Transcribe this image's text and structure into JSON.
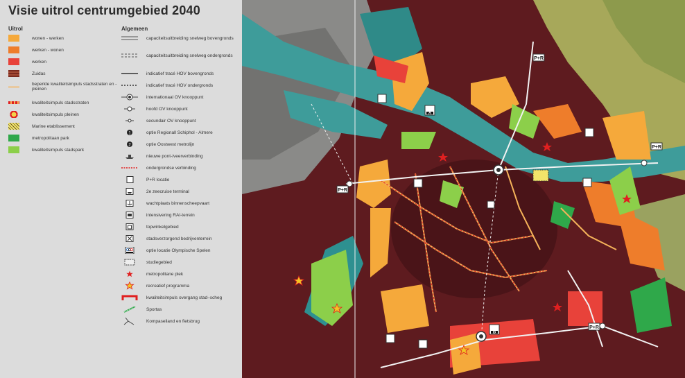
{
  "title": "Visie uitrol centrumgebied 2040",
  "legend": {
    "uitrol_heading": "Uitrol",
    "algemeen_heading": "Algemeen",
    "uitrol_items": [
      {
        "label": "wonen - werken",
        "color": "#f5a93b"
      },
      {
        "label": "werken - wonen",
        "color": "#ee7d2b"
      },
      {
        "label": "werken",
        "color": "#e8423a"
      },
      {
        "label": "Zuidas",
        "color": "#7a2a1e"
      },
      {
        "label": "beperkte kwaliteitsimpuls stadsstraten en -pleinen",
        "color": "#e8c9a0"
      },
      {
        "label": "kwaliteitsimpuls stadsstraten",
        "color": "#e02020"
      },
      {
        "label": "kwaliteitsimpuls pleinen",
        "color": "#f2d24a"
      },
      {
        "label": "Marine etablissement",
        "color": "#f2e46a"
      },
      {
        "label": "metropolitaan park",
        "color": "#2fa84a"
      },
      {
        "label": "kwaliteitsimpuls stadspark",
        "color": "#8ccf4a"
      }
    ],
    "algemeen_items": [
      {
        "label": "capaciteitsuitbreiding snelweg bovengronds",
        "icon": "double-line-icon"
      },
      {
        "label": "capaciteitsuitbreiding snelweg ondergronds",
        "icon": "double-dashed-line-icon"
      },
      {
        "label": "indicatief tracé HOV bovengronds",
        "icon": "solid-line-icon"
      },
      {
        "label": "indicatief tracé HOV ondergronds",
        "icon": "dashed-line-icon"
      },
      {
        "label": "internationaal OV knooppunt",
        "icon": "large-node-icon"
      },
      {
        "label": "hoofd OV knooppunt",
        "icon": "medium-node-icon"
      },
      {
        "label": "secundair OV knooppunt",
        "icon": "small-node-icon"
      },
      {
        "label": "optie Regionall Schiphol - Almere",
        "icon": "option-one-icon"
      },
      {
        "label": "optie Oostwest metrolijn",
        "icon": "option-two-icon"
      },
      {
        "label": "nieuwe pont-/veerverbinding",
        "icon": "ferry-icon"
      },
      {
        "label": "ondergrondse verbinding",
        "icon": "red-dotted-line-icon"
      },
      {
        "label": "P+R locatie",
        "icon": "park-and-ride-icon"
      },
      {
        "label": "2e zeecruise terminal",
        "icon": "cruise-terminal-icon"
      },
      {
        "label": "wachtplaats binnenscheepvaart",
        "icon": "anchor-icon"
      },
      {
        "label": "intensivering RAI-terrein",
        "icon": "rai-icon"
      },
      {
        "label": "topwinkelgebied",
        "icon": "shopping-icon"
      },
      {
        "label": "stadsverzorgend bedrijventerrein",
        "icon": "tools-icon"
      },
      {
        "label": "optie locatie Olympische Spelen",
        "icon": "olympic-rings-icon"
      },
      {
        "label": "studiegebied",
        "icon": "study-area-icon"
      },
      {
        "label": "metropolitane plek",
        "icon": "red-star-icon"
      },
      {
        "label": "recreatief programma",
        "icon": "yellow-star-icon"
      },
      {
        "label": "kwaliteitsimpuls overgang stad–scheg",
        "icon": "red-bracket-icon"
      },
      {
        "label": "Sportas",
        "icon": "sportas-icon"
      },
      {
        "label": "Kompaseiland en fietsbrug",
        "icon": "bridge-icon"
      }
    ]
  },
  "map": {
    "markers": {
      "pr": "P+R",
      "node_a": "A",
      "node_b": "B"
    }
  }
}
